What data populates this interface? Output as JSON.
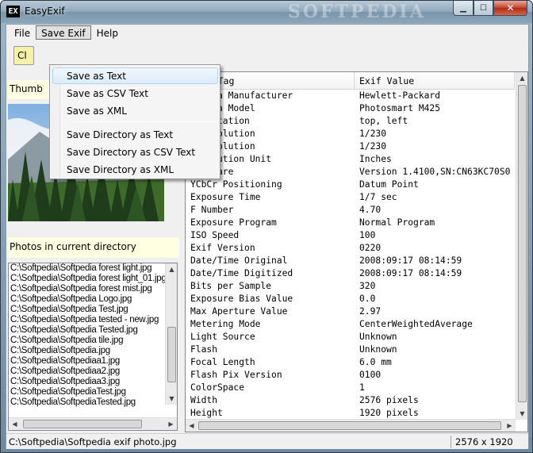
{
  "window": {
    "icon_text": "EX",
    "title": "EasyExif",
    "watermark": "SOFTPEDIA",
    "min_glyph": "▁",
    "max_glyph": "☐",
    "close_glyph": "✕"
  },
  "menubar": {
    "items": [
      {
        "label": "File"
      },
      {
        "label": "Save Exif"
      },
      {
        "label": "Help"
      }
    ]
  },
  "toolbar": {
    "button_label": "Cl"
  },
  "left": {
    "thumbnail_label": "Thumb",
    "photos_label": "Photos in current directory",
    "files": [
      "C:\\Softpedia\\Softpedia forest light.jpg",
      "C:\\Softpedia\\Softpedia forest light_01.jpg",
      "C:\\Softpedia\\Softpedia forest mist.jpg",
      "C:\\Softpedia\\Softpedia Logo.jpg",
      "C:\\Softpedia\\Softpedia Test.jpg",
      "C:\\Softpedia\\Softpedia tested - new.jpg",
      "C:\\Softpedia\\Softpedia Tested.jpg",
      "C:\\Softpedia\\Softpedia tile.jpg",
      "C:\\Softpedia\\Softpedia.jpg",
      "C:\\Softpedia\\Softpediaa1.jpg",
      "C:\\Softpedia\\Softpediaa2.jpg",
      "C:\\Softpedia\\Softpediaa3.jpg",
      "C:\\Softpedia\\SoftpediaTest.jpg",
      "C:\\Softpedia\\SoftpediaTested.jpg"
    ]
  },
  "exif": {
    "col_tag": "Exif Tag",
    "col_value": "Exif Value",
    "rows": [
      {
        "tag": "Camera Manufacturer",
        "value": "Hewlett-Packard"
      },
      {
        "tag": "Camera Model",
        "value": "Photosmart M425"
      },
      {
        "tag": "Orientation",
        "value": "top, left"
      },
      {
        "tag": "X Resolution",
        "value": "1/230"
      },
      {
        "tag": "Y Resolution",
        "value": "1/230"
      },
      {
        "tag": "Resolution Unit",
        "value": "Inches"
      },
      {
        "tag": "Software",
        "value": "Version 1.4100,SN:CN63KC70S0"
      },
      {
        "tag": "YCbCr Positioning",
        "value": "Datum Point"
      },
      {
        "tag": "Exposure Time",
        "value": "1/7 sec"
      },
      {
        "tag": "F Number",
        "value": "4.70"
      },
      {
        "tag": "Exposure Program",
        "value": "Normal Program"
      },
      {
        "tag": "ISO Speed",
        "value": "100"
      },
      {
        "tag": "Exif Version",
        "value": "0220"
      },
      {
        "tag": "Date/Time Original",
        "value": "2008:09:17 08:14:59"
      },
      {
        "tag": "Date/Time Digitized",
        "value": "2008:09:17 08:14:59"
      },
      {
        "tag": "Bits per Sample",
        "value": "320"
      },
      {
        "tag": "Exposure Bias Value",
        "value": "0.0"
      },
      {
        "tag": "Max Aperture Value",
        "value": "2.97"
      },
      {
        "tag": "Metering Mode",
        "value": "CenterWeightedAverage"
      },
      {
        "tag": "Light Source",
        "value": "Unknown"
      },
      {
        "tag": "Flash",
        "value": "Unknown"
      },
      {
        "tag": "Focal Length",
        "value": "6.0 mm"
      },
      {
        "tag": "Flash Pix Version",
        "value": "0100"
      },
      {
        "tag": "ColorSpace",
        "value": "1"
      },
      {
        "tag": "Width",
        "value": "2576 pixels"
      },
      {
        "tag": "Height",
        "value": "1920 pixels"
      }
    ]
  },
  "status": {
    "path": "C:\\Softpedia\\Softpedia exif photo.jpg",
    "size": "2576 x 1920"
  },
  "dropdown": {
    "items": [
      {
        "label": "Save as Text"
      },
      {
        "label": "Save as CSV Text"
      },
      {
        "label": "Save as XML"
      },
      {
        "label": "Save Directory as Text"
      },
      {
        "label": "Save Directory as  CSV Text"
      },
      {
        "label": "Save Directory as XML"
      }
    ]
  },
  "icons": {
    "arrow_up": "▲",
    "arrow_down": "▼",
    "arrow_left": "◀",
    "arrow_right": "▶"
  }
}
